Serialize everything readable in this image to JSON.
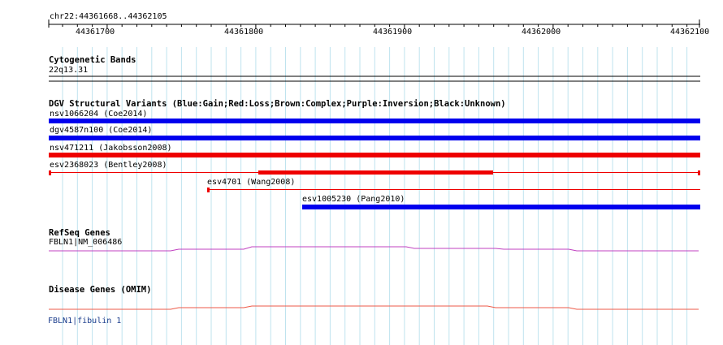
{
  "region": {
    "label": "chr22:44361668..44362105",
    "start": 44361668,
    "end": 44362105
  },
  "ruler": {
    "ticks": [
      "44361700",
      "44361800",
      "44361900",
      "44362000",
      "44362100"
    ]
  },
  "tracks": {
    "cytoband": {
      "title": "Cytogenetic Bands",
      "band": "22q13.31"
    },
    "dgv": {
      "title": "DGV Structural Variants (Blue:Gain;Red:Loss;Brown:Complex;Purple:Inversion;Black:Unknown)",
      "variants": [
        {
          "id": "nsv1066204",
          "label": "nsv1066204 (Coe2014)",
          "type": "gain"
        },
        {
          "id": "dgv4587n100",
          "label": "dgv4587n100 (Coe2014)",
          "type": "gain"
        },
        {
          "id": "nsv471211",
          "label": "nsv471211 (Jakobsson2008)",
          "type": "loss"
        },
        {
          "id": "esv2368023",
          "label": "esv2368023 (Bentley2008)",
          "type": "loss"
        },
        {
          "id": "esv4701",
          "label": "esv4701 (Wang2008)",
          "type": "loss"
        },
        {
          "id": "esv1005230",
          "label": "esv1005230 (Pang2010)",
          "type": "gain"
        }
      ]
    },
    "refseq": {
      "title": "RefSeq Genes",
      "gene": "FBLN1|NM_006486"
    },
    "omim": {
      "title": "Disease Genes (OMIM)",
      "gene": "FBLN1|fibulin 1"
    }
  },
  "colors": {
    "gain": "#0000ee",
    "loss": "#ee0000",
    "grid": "#bfe3ee",
    "refseq": "#c040c0",
    "omim": "#ee5a48",
    "label_blue": "#1a3c8c"
  }
}
